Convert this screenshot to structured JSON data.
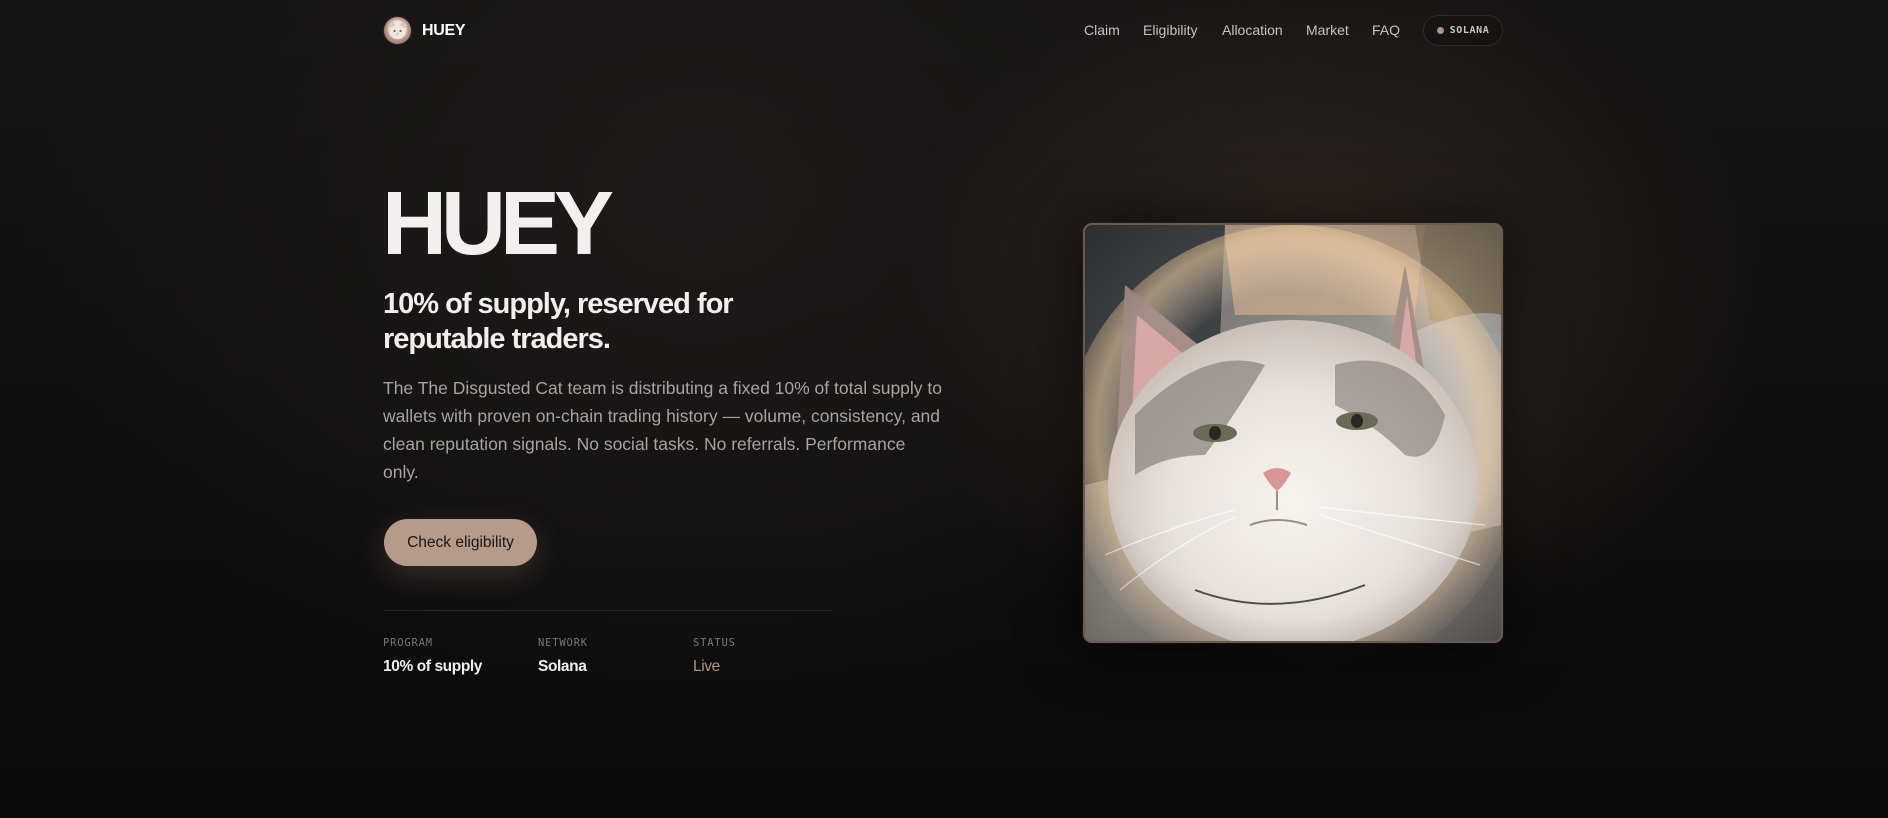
{
  "nav": {
    "brand_name": "HUEY",
    "brand_icon": "cat-avatar-icon",
    "links": [
      "Claim",
      "Eligibility",
      "Allocation",
      "Market",
      "FAQ"
    ],
    "network_badge": "SOLANA"
  },
  "hero": {
    "title": "HUEY",
    "subtitle": "10% of supply, reserved for reputable traders.",
    "description": "The The Disgusted Cat team is distributing a fixed 10% of total supply to wallets with proven on-chain trading history — volume, consistency, and clean reputation signals. No social tasks. No referrals. Performance only.",
    "cta_label": "Check eligibility"
  },
  "stats": [
    {
      "label": "PROGRAM",
      "value": "10% of supply"
    },
    {
      "label": "NETWORK",
      "value": "Solana"
    },
    {
      "label": "STATUS",
      "value": "Live"
    }
  ],
  "colors": {
    "accent": "#b69a8a",
    "background": "#121111",
    "text": "#f2eeeb",
    "muted": "#aaa29d"
  }
}
